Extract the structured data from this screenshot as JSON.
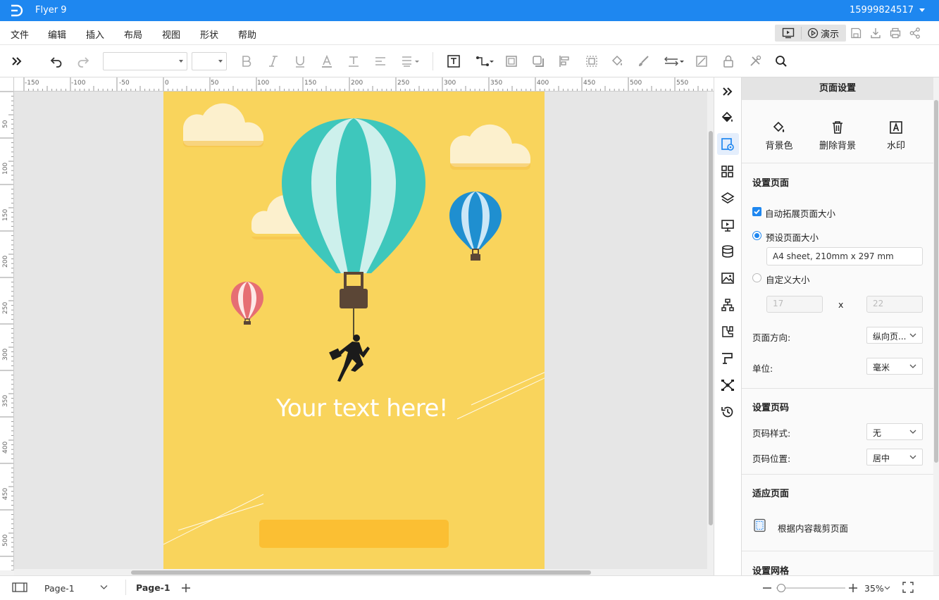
{
  "app": {
    "title": "Flyer 9",
    "user": "15999824517"
  },
  "menu": [
    "文件",
    "编辑",
    "插入",
    "布局",
    "视图",
    "形状",
    "帮助"
  ],
  "menu_right": {
    "present_label": "演示"
  },
  "ruler": {
    "top_ticks": [
      "-150",
      "-100",
      "-50",
      "0",
      "50",
      "100",
      "150",
      "200",
      "250",
      "300",
      "350",
      "400",
      "450",
      "500",
      "550"
    ],
    "left_ticks": [
      "50",
      "100",
      "150",
      "200",
      "250",
      "300",
      "350",
      "400",
      "450",
      "500"
    ]
  },
  "canvas": {
    "headline": "Your text here!"
  },
  "panel": {
    "title": "页面设置",
    "background_actions": [
      "背景色",
      "删除背景",
      "水印"
    ],
    "setup_page": {
      "heading": "设置页面",
      "auto_expand_label": "自动拓展页面大小",
      "preset_label": "预设页面大小",
      "preset_value": "A4 sheet, 210mm x 297 mm",
      "custom_label": "自定义大小",
      "custom_width": "17",
      "custom_height": "22",
      "x_label": "x",
      "orientation_label": "页面方向:",
      "orientation_value": "纵向页...",
      "unit_label": "单位:",
      "unit_value": "毫米"
    },
    "page_number": {
      "heading": "设置页码",
      "style_label": "页码样式:",
      "style_value": "无",
      "position_label": "页码位置:",
      "position_value": "居中"
    },
    "fit_page": {
      "heading": "适应页面",
      "crop_label": "根据内容裁剪页面"
    },
    "grid": {
      "heading": "设置网格"
    }
  },
  "status": {
    "page_select": "Page-1",
    "active_tab": "Page-1",
    "zoom": "35%"
  },
  "colors": {
    "accent": "#1e87f0",
    "page_bg": "#f9d45c",
    "balloon_teal": "#3ec7bc",
    "button_gold": "#fbbf33"
  }
}
